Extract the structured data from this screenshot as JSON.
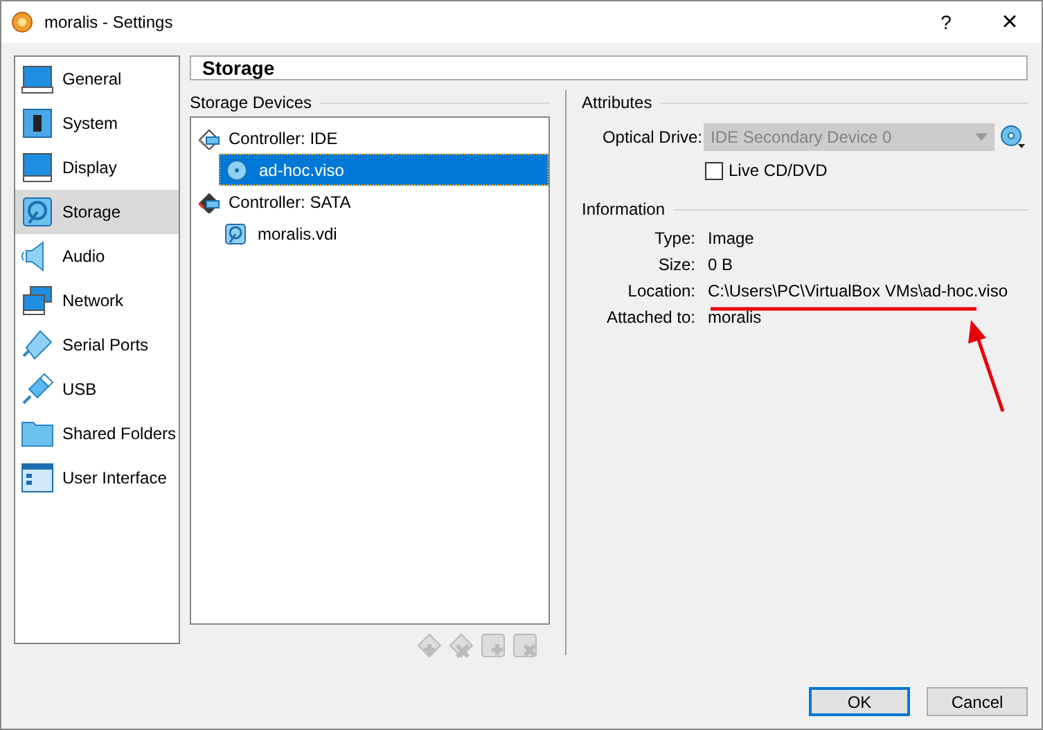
{
  "window": {
    "title": "moralis - Settings",
    "help_glyph": "?",
    "close_glyph": "×"
  },
  "sidebar": {
    "items": [
      {
        "label": "General",
        "kind": "general",
        "selected": false
      },
      {
        "label": "System",
        "kind": "system",
        "selected": false
      },
      {
        "label": "Display",
        "kind": "display",
        "selected": false
      },
      {
        "label": "Storage",
        "kind": "storage",
        "selected": true
      },
      {
        "label": "Audio",
        "kind": "audio",
        "selected": false
      },
      {
        "label": "Network",
        "kind": "network",
        "selected": false
      },
      {
        "label": "Serial Ports",
        "kind": "serial",
        "selected": false
      },
      {
        "label": "USB",
        "kind": "usb",
        "selected": false
      },
      {
        "label": "Shared Folders",
        "kind": "folder",
        "selected": false
      },
      {
        "label": "User Interface",
        "kind": "ui",
        "selected": false
      }
    ]
  },
  "page_title": "Storage",
  "storage_devices": {
    "heading": "Storage Devices",
    "tree": [
      {
        "label": "Controller: IDE",
        "kind": "ide",
        "children": [
          {
            "label": "ad-hoc.viso",
            "kind": "optical",
            "selected": true
          }
        ]
      },
      {
        "label": "Controller: SATA",
        "kind": "sata",
        "children": [
          {
            "label": "moralis.vdi",
            "kind": "disk",
            "selected": false
          }
        ]
      }
    ]
  },
  "attributes": {
    "heading": "Attributes",
    "optical_drive_label": "Optical Drive:",
    "optical_drive_value": "IDE Secondary Device 0",
    "optical_drive_disabled": true,
    "live_cd": {
      "label": "Live CD/DVD",
      "checked": false
    }
  },
  "information": {
    "heading": "Information",
    "rows": [
      {
        "label": "Type:",
        "value": "Image"
      },
      {
        "label": "Size:",
        "value": "0 B"
      },
      {
        "label": "Location:",
        "value": "C:\\Users\\PC\\VirtualBox VMs\\ad-hoc.viso"
      },
      {
        "label": "Attached to:",
        "value": "moralis"
      }
    ]
  },
  "buttons": [
    {
      "label": "OK",
      "default": true
    },
    {
      "label": "Cancel",
      "default": false
    }
  ]
}
